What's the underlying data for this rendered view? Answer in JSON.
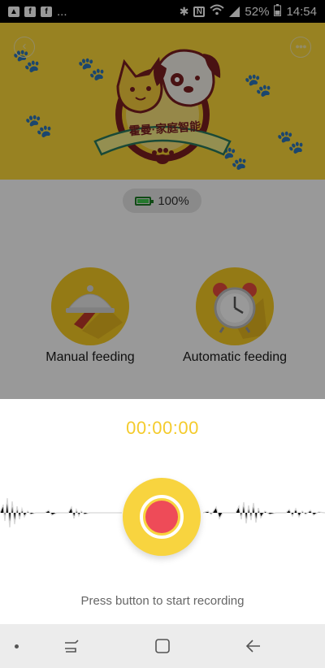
{
  "status_bar": {
    "left_icons": [
      "image-icon",
      "facebook-icon",
      "facebook-icon"
    ],
    "more": "...",
    "battery_percent": "52%",
    "time": "14:54",
    "right_icons": [
      "bluetooth-icon",
      "nfc-icon",
      "wifi-icon",
      "signal-icon",
      "battery-icon"
    ]
  },
  "header": {
    "back_icon": "chevron-left-icon",
    "more_icon": "more-icon",
    "logo_text": "霍曼·家庭智能"
  },
  "device": {
    "battery_level": "100%"
  },
  "actions": [
    {
      "label": "Manual feeding",
      "icon": "food-cloche-icon"
    },
    {
      "label": "Automatic feeding",
      "icon": "alarm-clock-icon"
    }
  ],
  "recording": {
    "timer": "00:00:00",
    "hint": "Press button to start recording",
    "button_color": "#ee4b58"
  },
  "nav_bar": {
    "items": [
      "dot-icon",
      "recent-apps-icon",
      "home-icon",
      "back-icon"
    ]
  },
  "colors": {
    "brand_yellow": "#fdd93a",
    "accent_yellow": "#f4cb2c",
    "record_red": "#ee4b58"
  }
}
